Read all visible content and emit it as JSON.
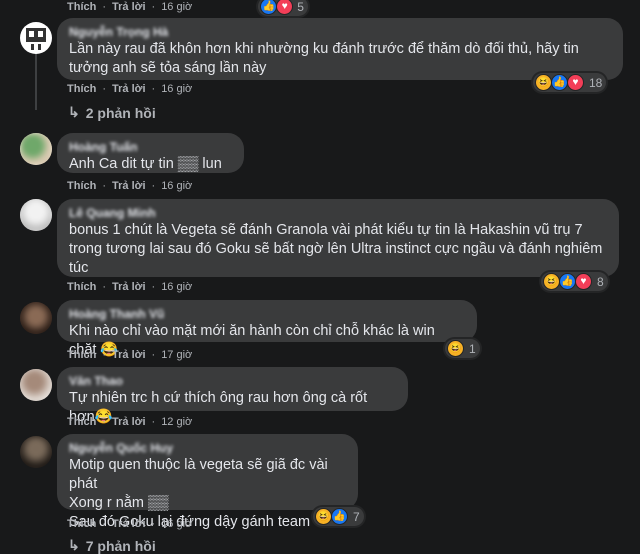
{
  "top": {
    "like": "Thích",
    "reply": "Trả lời",
    "time": "16 giờ",
    "count": "5"
  },
  "comments": [
    {
      "name": "Nguyễn Trọng Hà",
      "text": "Lần này rau đã khôn hơn khi nhường ku đánh trước để thăm dò đối thủ, hãy tin tưởng anh sẽ tỏa sáng lần này",
      "like": "Thích",
      "reply": "Trả lời",
      "time": "16 giờ",
      "reactions": [
        "haha",
        "like",
        "love"
      ],
      "count": "18",
      "replies_label": "2 phản hồi"
    },
    {
      "name": "Hoàng Tuấn",
      "text": "Anh Ca dit tự tin ▒▒ lun",
      "like": "Thích",
      "reply": "Trả lời",
      "time": "16 giờ"
    },
    {
      "name": "Lê Quang Minh",
      "text": "bonus 1 chút là Vegeta sẽ đánh Granola vài phát kiểu tự tin là Hakashin vũ trụ 7 trong tương lai sau đó Goku sẽ bất ngờ lên Ultra instinct cực ngầu và đánh nghiêm túc",
      "like": "Thích",
      "reply": "Trả lời",
      "time": "16 giờ",
      "reactions": [
        "haha",
        "like",
        "love"
      ],
      "count": "8"
    },
    {
      "name": "Hoàng Thanh Vũ",
      "text": "Khi nào chỉ vào mặt mới ăn hành còn chỉ chỗ khác là win chặt 😂",
      "like": "Thích",
      "reply": "Trả lời",
      "time": "17 giờ",
      "reactions": [
        "haha"
      ],
      "count": "1"
    },
    {
      "name": "Văn Thao",
      "text": "Tự nhiên trc h cứ thích ông rau hơn ông cà rốt hơn😂",
      "like": "Thích",
      "reply": "Trả lời",
      "time": "12 giờ"
    },
    {
      "name": "Nguyễn Quốc Huy",
      "text_lines": [
        "Motip quen thuộc là vegeta sẽ giã đc vài phát",
        "Xong r nằm ▒▒",
        "Sau đó Goku lại đứng dậy gánh team"
      ],
      "like": "Thích",
      "reply": "Trả lời",
      "time": "16 giờ",
      "reactions": [
        "haha",
        "like"
      ],
      "count": "7",
      "replies_label": "7 phản hồi"
    }
  ]
}
